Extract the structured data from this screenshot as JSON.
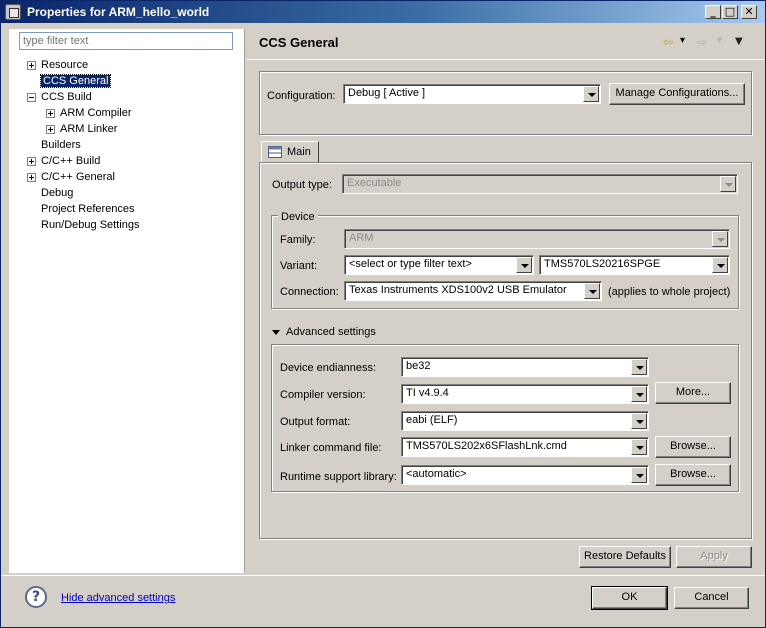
{
  "window": {
    "title": "Properties for ARM_hello_world",
    "minimize": "_",
    "maximize": "□",
    "close": "✕"
  },
  "filter": {
    "placeholder": "type filter text"
  },
  "tree": [
    {
      "label": "Resource",
      "expander": "plus",
      "indent": 0
    },
    {
      "label": "CCS General",
      "expander": "none",
      "indent": 0,
      "selected": true
    },
    {
      "label": "CCS Build",
      "expander": "minus",
      "indent": 0
    },
    {
      "label": "ARM Compiler",
      "expander": "plus",
      "indent": 1
    },
    {
      "label": "ARM Linker",
      "expander": "plus",
      "indent": 1
    },
    {
      "label": "Builders",
      "expander": "none",
      "indent": 0
    },
    {
      "label": "C/C++ Build",
      "expander": "plus",
      "indent": 0
    },
    {
      "label": "C/C++ General",
      "expander": "plus",
      "indent": 0
    },
    {
      "label": "Debug",
      "expander": "none",
      "indent": 0
    },
    {
      "label": "Project References",
      "expander": "none",
      "indent": 0
    },
    {
      "label": "Run/Debug Settings",
      "expander": "none",
      "indent": 0
    }
  ],
  "page": {
    "title": "CCS General",
    "nav": {
      "back": "⇦",
      "forward": "⇨",
      "dropdown": "▾",
      "menu": "▼"
    }
  },
  "configuration": {
    "label": "Configuration:",
    "value": "Debug  [ Active ]",
    "manage_button": "Manage Configurations..."
  },
  "tabs": [
    {
      "label": "Main",
      "icon": "table-icon"
    }
  ],
  "main": {
    "output_type": {
      "label": "Output type:",
      "value": "Executable"
    },
    "device": {
      "legend": "Device",
      "family": {
        "label": "Family:",
        "value": "ARM"
      },
      "variant": {
        "label": "Variant:",
        "filter_value": "<select or type filter text>",
        "value": "TMS570LS20216SPGE"
      },
      "connection": {
        "label": "Connection:",
        "value": "Texas Instruments XDS100v2 USB Emulator",
        "note": "(applies to whole project)"
      }
    },
    "advanced": {
      "toggle_label": "Advanced settings",
      "endianness": {
        "label": "Device endianness:",
        "value": "be32"
      },
      "compiler": {
        "label": "Compiler version:",
        "value": "TI v4.9.4",
        "button": "More..."
      },
      "output_format": {
        "label": "Output format:",
        "value": "eabi (ELF)"
      },
      "linker_cmd": {
        "label": "Linker command file:",
        "value": "TMS570LS202x6SFlashLnk.cmd",
        "button": "Browse..."
      },
      "runtime_lib": {
        "label": "Runtime support library:",
        "value": "<automatic>",
        "button": "Browse..."
      }
    }
  },
  "footer": {
    "restore_defaults": "Restore Defaults",
    "apply": "Apply",
    "help_icon_glyph": "?",
    "hide_advanced": "Hide advanced settings",
    "ok": "OK",
    "cancel": "Cancel"
  }
}
